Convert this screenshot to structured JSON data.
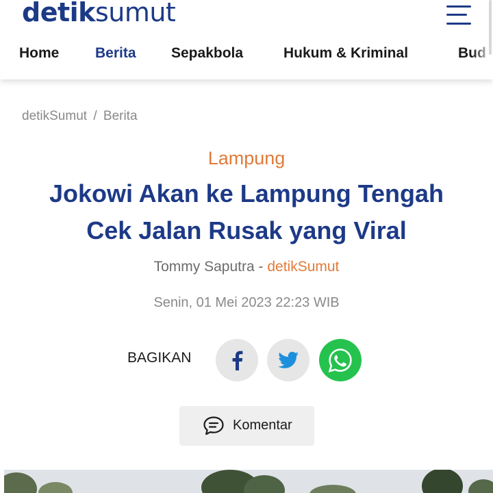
{
  "header": {
    "logo_part1": "detik",
    "logo_part2": "sumut",
    "nav": [
      {
        "label": "Home",
        "active": false
      },
      {
        "label": "Berita",
        "active": true
      },
      {
        "label": "Sepakbola",
        "active": false
      },
      {
        "label": "Hukum & Kriminal",
        "active": false
      },
      {
        "label": "Bud",
        "active": false
      }
    ]
  },
  "breadcrumb": {
    "items": [
      "detikSumut",
      "Berita"
    ],
    "separator": "/"
  },
  "article": {
    "category": "Lampung",
    "title_line1": "Jokowi Akan ke Lampung Tengah",
    "title_line2": "Cek Jalan Rusak yang Viral",
    "author": "Tommy Saputra",
    "author_separator": "-",
    "source": "detikSumut",
    "date": "Senin, 01 Mei 2023 22:23 WIB"
  },
  "share": {
    "label": "BAGIKAN",
    "buttons": [
      "facebook-icon",
      "twitter-icon",
      "whatsapp-icon"
    ]
  },
  "comment": {
    "label": "Komentar"
  },
  "colors": {
    "brand_blue": "#1d3a87",
    "accent_orange": "#e07b3a",
    "whatsapp_green": "#25c24e"
  }
}
